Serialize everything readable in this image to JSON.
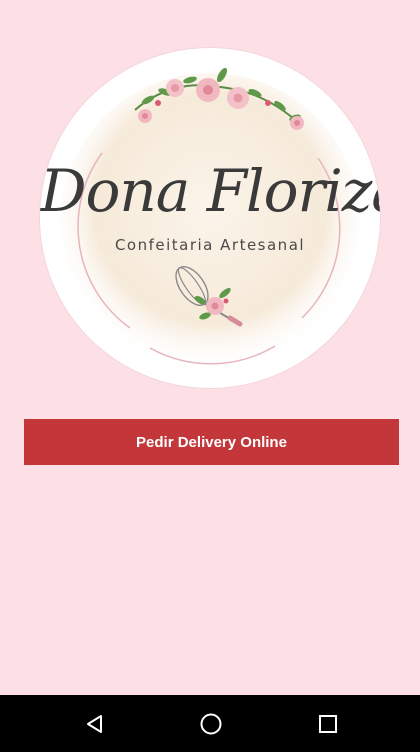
{
  "app": {
    "logo": {
      "brand_name": "Dona Floriza",
      "subtitle": "Confeitaria Artesanal"
    },
    "actions": {
      "delivery_button_label": "Pedir Delivery Online"
    }
  },
  "navigation_bar": {
    "buttons": [
      {
        "icon": "back-icon"
      },
      {
        "icon": "home-icon"
      },
      {
        "icon": "recent-apps-icon"
      }
    ]
  },
  "colors": {
    "background": "#fde0e6",
    "button": "#c3363a",
    "navbar": "#000000"
  }
}
